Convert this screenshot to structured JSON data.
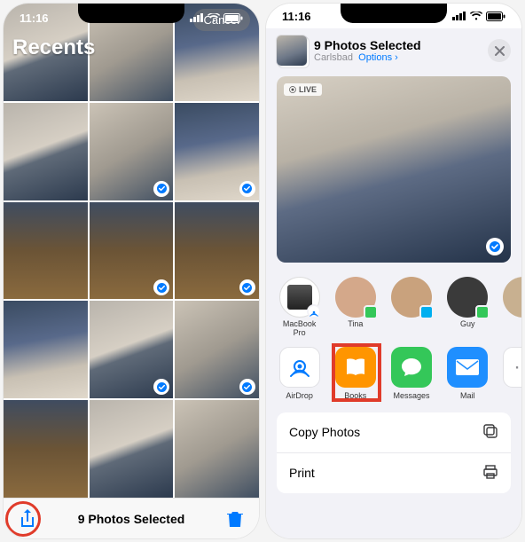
{
  "statusbar": {
    "time": "11:16"
  },
  "left": {
    "album_title": "Recents",
    "cancel": "Cancel",
    "selected_count_label": "9 Photos Selected",
    "grid_cells": 15,
    "selected_indices": [
      4,
      5,
      7,
      8,
      10,
      11
    ]
  },
  "right": {
    "header_title": "9 Photos Selected",
    "header_location": "Carlsbad",
    "header_options": "Options",
    "live_badge": "LIVE",
    "contacts": [
      {
        "name": "MacBook Pro",
        "badge": "airdrop"
      },
      {
        "name": "Tina",
        "badge": "messages"
      },
      {
        "name": "",
        "badge": "skype"
      },
      {
        "name": "Guy",
        "badge": "messages"
      }
    ],
    "apps": [
      {
        "name": "AirDrop",
        "key": "airdrop"
      },
      {
        "name": "Books",
        "key": "books"
      },
      {
        "name": "Messages",
        "key": "messages"
      },
      {
        "name": "Mail",
        "key": "mail"
      }
    ],
    "actions": [
      {
        "label": "Copy Photos",
        "icon": "copy"
      },
      {
        "label": "Print",
        "icon": "print"
      }
    ]
  },
  "colors": {
    "ios_blue": "#007aff",
    "highlight_red": "#e03b2a",
    "books_orange": "#ff9500",
    "messages_green": "#34c759",
    "mail_blue": "#1f8fff"
  }
}
